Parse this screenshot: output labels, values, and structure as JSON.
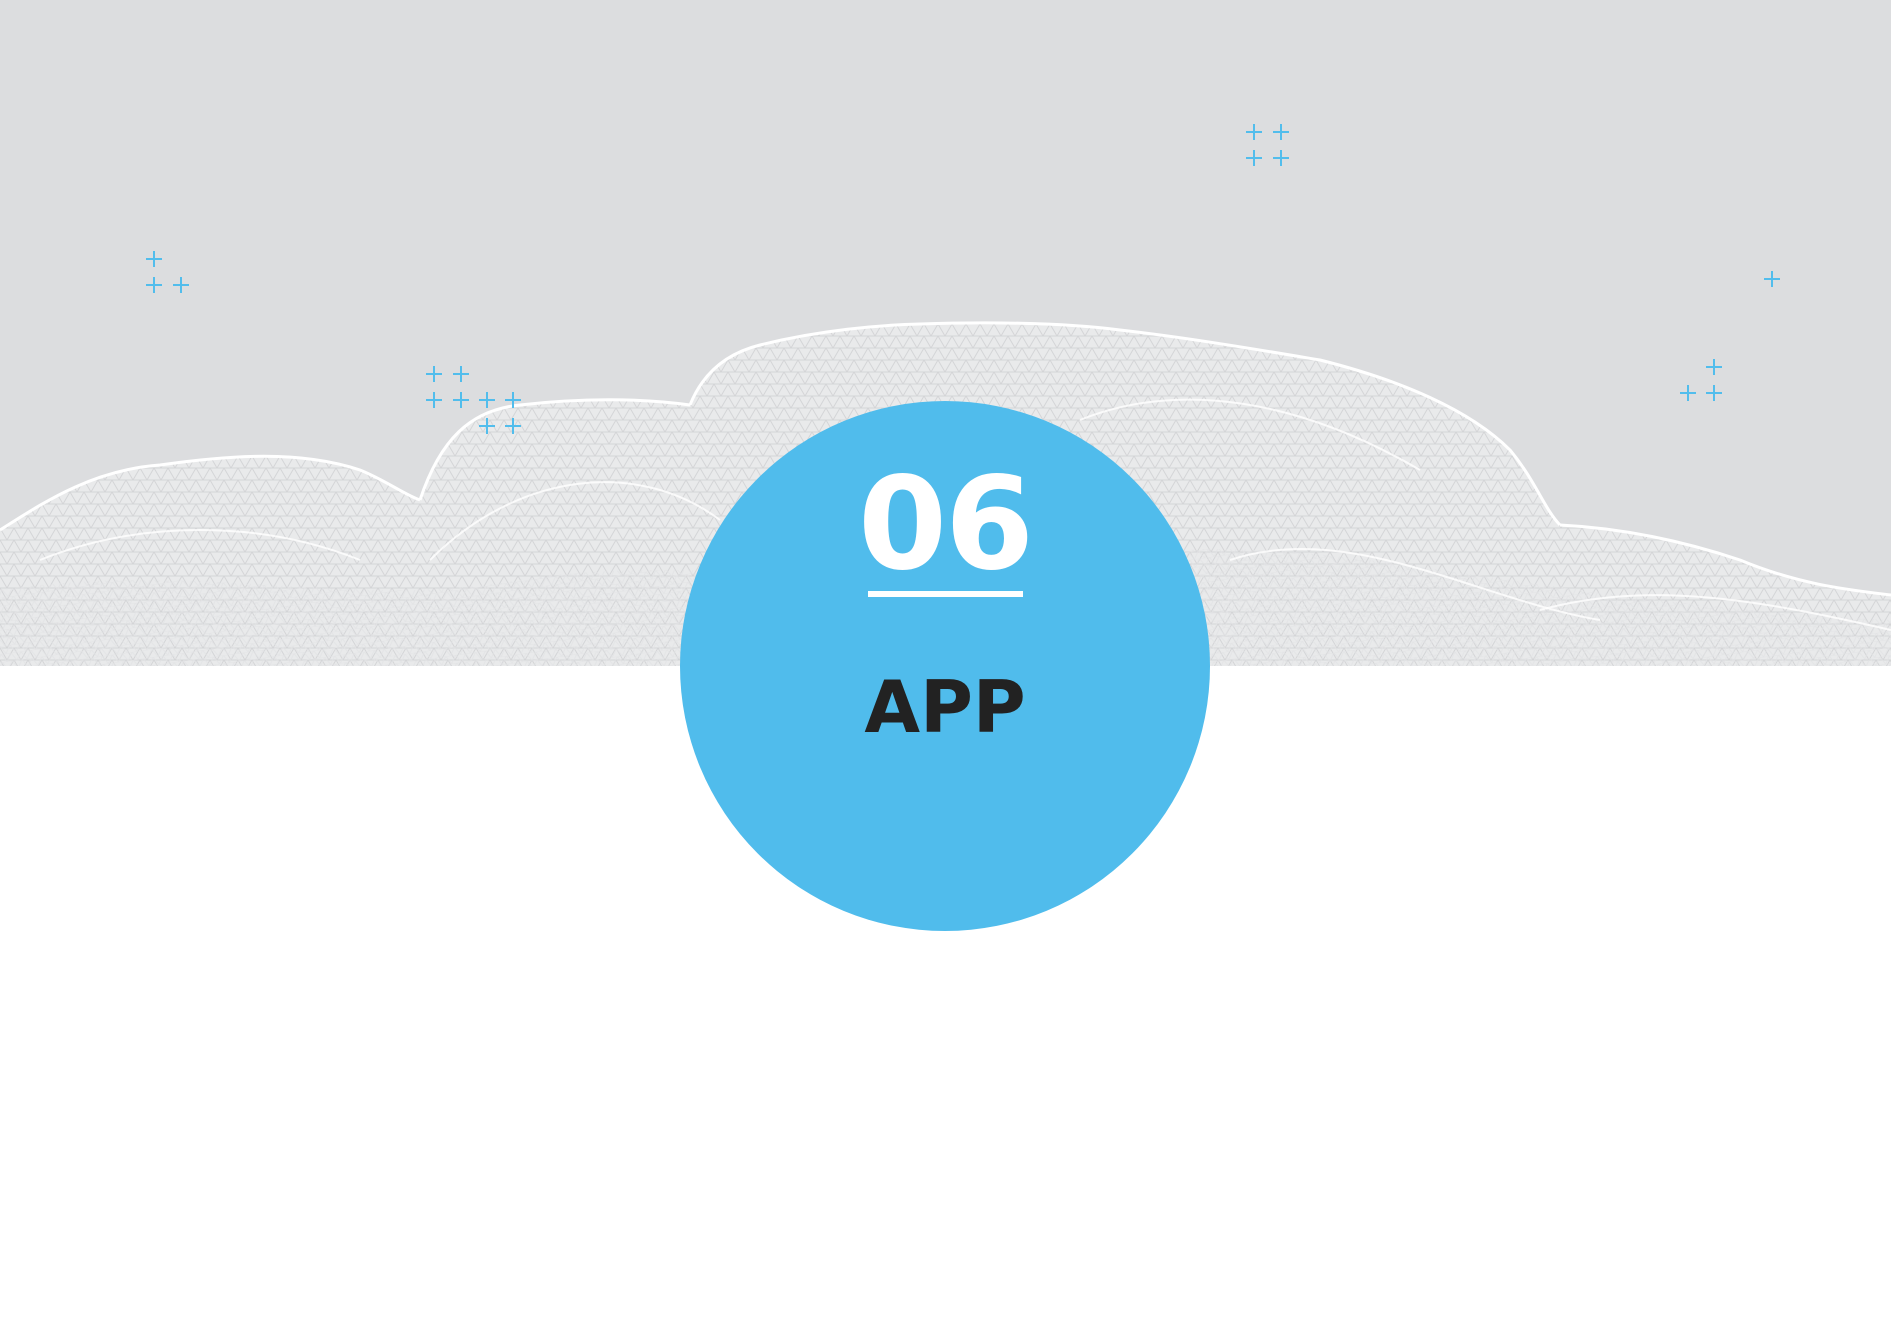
{
  "section": {
    "number": "06",
    "title": "APP"
  },
  "colors": {
    "background_top": "#dcdddf",
    "background_bottom": "#ffffff",
    "accent": "#50bcec",
    "terrain": "#ffffff",
    "title": "#222222"
  },
  "icons": [
    "plus-icon",
    "wireframe-terrain"
  ]
}
